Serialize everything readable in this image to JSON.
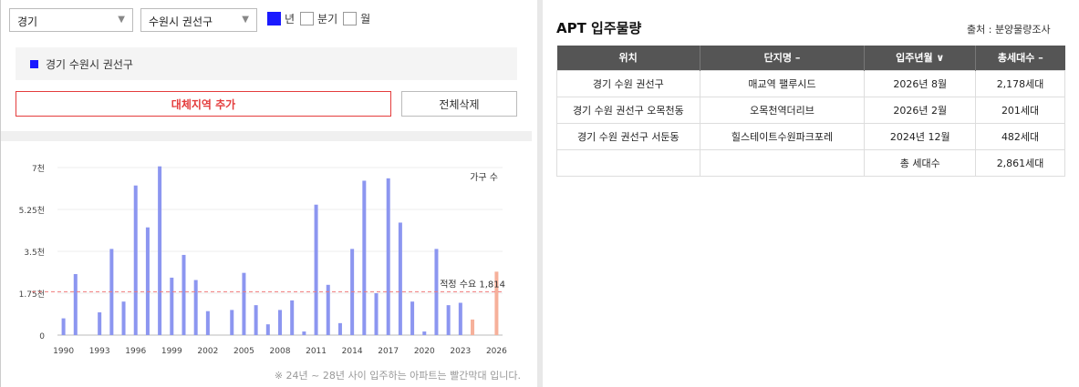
{
  "filters": {
    "province": "경기",
    "district": "수원시 권선구",
    "options": [
      {
        "label": "년",
        "checked": true
      },
      {
        "label": "분기",
        "checked": false
      },
      {
        "label": "월",
        "checked": false
      }
    ]
  },
  "region_label": "경기 수원시 권선구",
  "buttons": {
    "add": "대체지역 추가",
    "delete_all": "전체삭제"
  },
  "footnote": "※ 24년 ~ 28년 사이 입주하는 아파트는 빨간막대 입니다.",
  "colors": {
    "bar": "#8c96f0",
    "highlight": "#f6b09a",
    "line": "#f07a7a",
    "accent": "#1a1aff"
  },
  "chart_data": {
    "type": "bar",
    "series_label": "가구 수",
    "x": [
      1990,
      1991,
      1992,
      1993,
      1994,
      1995,
      1996,
      1997,
      1998,
      1999,
      2000,
      2001,
      2002,
      2003,
      2004,
      2005,
      2006,
      2007,
      2008,
      2009,
      2010,
      2011,
      2012,
      2013,
      2014,
      2015,
      2016,
      2017,
      2018,
      2019,
      2020,
      2021,
      2022,
      2023,
      2024,
      2025,
      2026
    ],
    "values": [
      700,
      2550,
      0,
      950,
      3600,
      1400,
      6250,
      4500,
      7050,
      2400,
      3350,
      2300,
      1000,
      0,
      1050,
      2600,
      1250,
      450,
      1050,
      1450,
      150,
      5450,
      2100,
      500,
      3600,
      6450,
      1750,
      6550,
      4700,
      1400,
      150,
      3600,
      1250,
      1350,
      650,
      0,
      2650
    ],
    "highlight_from": 2024,
    "xticks": [
      "1990",
      "1993",
      "1996",
      "1999",
      "2002",
      "2005",
      "2008",
      "2011",
      "2014",
      "2017",
      "2020",
      "2023",
      "2026"
    ],
    "yticks": [
      "0",
      "1.75천",
      "3.5천",
      "5.25천",
      "7천"
    ],
    "ylim": [
      0,
      7000
    ],
    "reference": {
      "label": "적정 수요 1,814",
      "value": 1814
    }
  },
  "apt_table": {
    "title": "APT 입주물량",
    "source": "출처 : 분양물량조사",
    "headers": [
      "위치",
      "단지명 –",
      "입주년월 ∨",
      "총세대수 –"
    ],
    "rows": [
      [
        "경기 수원 권선구",
        "매교역 팰루시드",
        "2026년 8월",
        "2,178세대"
      ],
      [
        "경기 수원 권선구 오목천동",
        "오목천역더리브",
        "2026년 2월",
        "201세대"
      ],
      [
        "경기 수원 권선구 서둔동",
        "힐스테이트수원파크포레",
        "2024년 12월",
        "482세대"
      ],
      [
        "",
        "",
        "총 세대수",
        "2,861세대"
      ]
    ]
  }
}
